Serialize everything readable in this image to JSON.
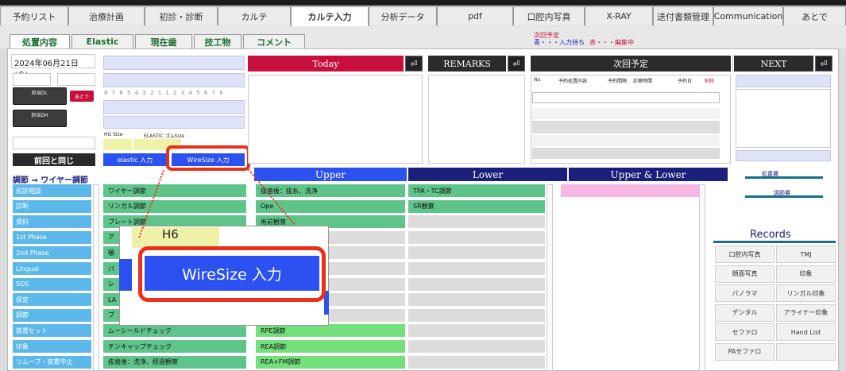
{
  "nav": {
    "tabs": [
      "予約リスト",
      "治療計画",
      "初診・診断",
      "カルテ",
      "カルテ入力",
      "分析データ",
      "pdf",
      "口腔内写真",
      "X-RAY",
      "送付書類管理",
      "Communication",
      "あとで"
    ]
  },
  "subtabs": [
    "処置内容",
    "Elastic",
    "現在歯",
    "技工物",
    "コメント"
  ],
  "notice": {
    "line1": "次回予定",
    "line2a": "青・・・入力待ち",
    "line2b": "赤・・・編集中"
  },
  "date": "2024年06月21日(金)",
  "staff": {
    "dr": "担当Dr.",
    "later": "あとで",
    "dh": "担当DH"
  },
  "teeth": "8 7 6 5 4 3 2 1 1 2 3 4 5 6 7 8",
  "sizes": {
    "hg": "HG Size",
    "elastic": "ELASTIC ゴムSize"
  },
  "buttons": {
    "same": "前回と同じ",
    "elastic": "elastic 入力",
    "wire": "WireSize 入力",
    "today": "Today",
    "remarks": "REMARKS",
    "next_plan": "次回予定",
    "next": "NEXT",
    "return": "⏎"
  },
  "plan_table": {
    "headers": [
      "No.",
      "予約処置内容",
      "予約間隔",
      "診察時間",
      "予約日"
    ],
    "delete": "削除"
  },
  "section_title": "調節 ⇒ ワイヤー調節",
  "columns": {
    "upper": "Upper",
    "lower": "Lower",
    "both": "Upper & Lower"
  },
  "categories": [
    "初診相談",
    "診断",
    "資料",
    "1st Phase",
    "2nd Phase",
    "Lingual",
    "SOS",
    "保定",
    "調節",
    "装置セット",
    "印象",
    "リムーブ・装置中止"
  ],
  "col1": [
    "ワイヤー調節",
    "リンガル調節",
    "プレート調節",
    "ア",
    "顎",
    "パ",
    "レ",
    "LA",
    "プ",
    "ムーシールドチェック",
    "チンキャップチェック",
    "抜歯後：洗浄、経過観察"
  ],
  "col2": [
    "抜歯後：抜糸、洗浄",
    "Ope",
    "術前観察",
    "",
    "",
    "",
    "",
    "",
    "",
    "RPE調節",
    "REA調節",
    "REA+FM調節"
  ],
  "col3": [
    "TPA・TC調節",
    "SR観察"
  ],
  "fees": {
    "treatment": "処置費",
    "adjust": "調節費"
  },
  "records": {
    "title": "Records",
    "items": [
      "口腔内写真",
      "TMJ",
      "顔面写真",
      "印象",
      "パノラマ",
      "リンガル印象",
      "デンタル",
      "アライナー印象",
      "セファロ",
      "Hand List",
      "PAセファロ",
      ""
    ]
  },
  "zoom": {
    "hg": "H6",
    "wire": "WireSize 入力"
  },
  "colors": {
    "accent_red": "#c8103e",
    "navy": "#1a1f7a",
    "button_blue": "#2b52f0",
    "highlight": "#e8301c"
  }
}
